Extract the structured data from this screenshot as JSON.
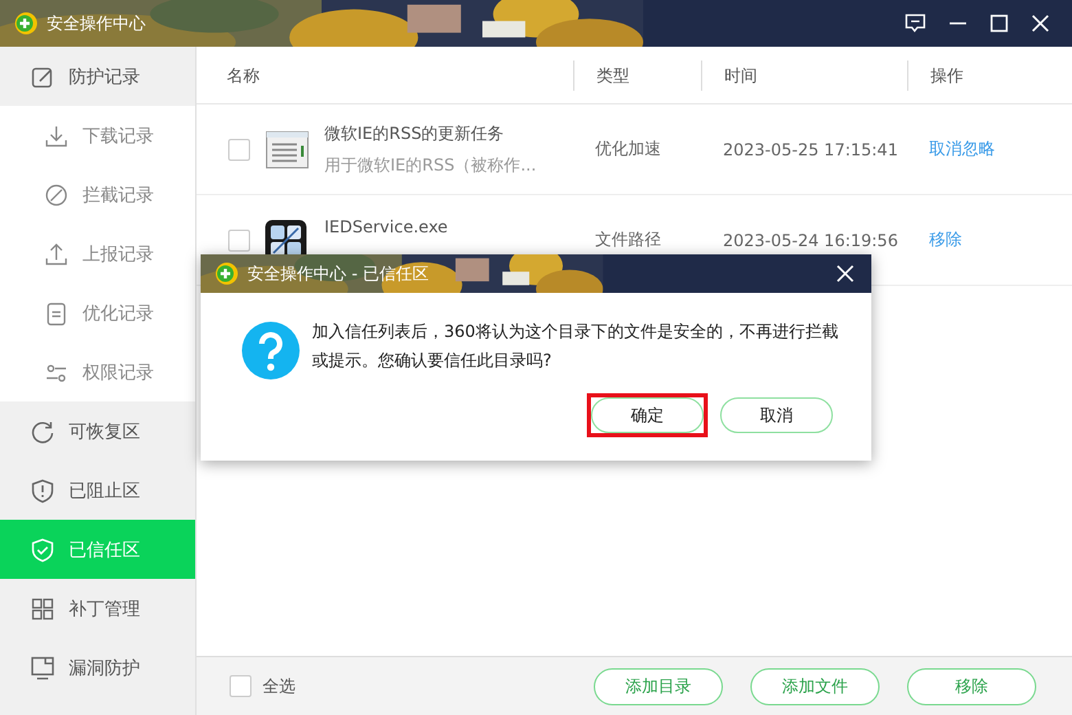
{
  "window": {
    "title": "安全操作中心"
  },
  "sidebar": {
    "items": [
      {
        "label": "防护记录",
        "selected": false,
        "children": [
          {
            "label": "下载记录",
            "selected": false
          },
          {
            "label": "拦截记录",
            "selected": false
          },
          {
            "label": "上报记录",
            "selected": false
          },
          {
            "label": "优化记录",
            "selected": false
          },
          {
            "label": "权限记录",
            "selected": false
          }
        ]
      },
      {
        "label": "可恢复区",
        "selected": false
      },
      {
        "label": "已阻止区",
        "selected": false
      },
      {
        "label": "已信任区",
        "selected": true
      },
      {
        "label": "补丁管理",
        "selected": false
      },
      {
        "label": "漏洞防护",
        "selected": false
      }
    ]
  },
  "table": {
    "columns": [
      "名称",
      "类型",
      "时间",
      "操作"
    ],
    "rows": [
      {
        "checked": false,
        "name": "微软IE的RSS的更新任务",
        "detail": "用于微软IE的RSS（被称作...",
        "type": "优化加速",
        "time": "2023-05-25 17:15:41",
        "action": "取消忽略"
      },
      {
        "checked": false,
        "name": "IEDService.exe",
        "type": "文件路径",
        "time": "2023-05-24 16:19:56",
        "action": "移除"
      }
    ]
  },
  "footer": {
    "select_all": {
      "label": "全选",
      "checked": false
    },
    "buttons": [
      "添加目录",
      "添加文件",
      "移除"
    ]
  },
  "dialog": {
    "title": "安全操作中心 - 已信任区",
    "message": "加入信任列表后，360将认为这个目录下的文件是安全的，不再进行拦截或提示。您确认要信任此目录吗?",
    "buttons": [
      {
        "label": "确定",
        "highlighted": true
      },
      {
        "label": "取消",
        "highlighted": false
      }
    ]
  }
}
